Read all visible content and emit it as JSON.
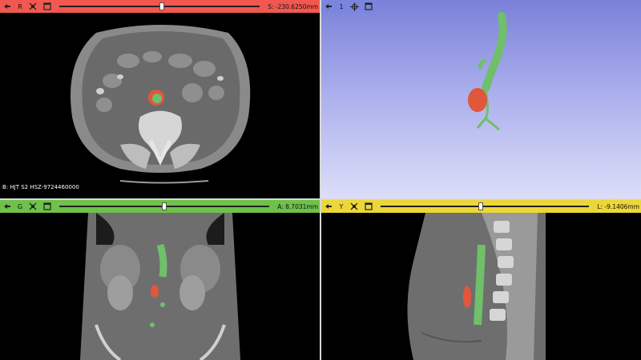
{
  "views": {
    "red": {
      "label": "R",
      "offset": "S: -230.6250mm",
      "slider_value": 0.51,
      "color": "#f2584f",
      "patient_id": "B: HJT S2 HSZ-9724460000"
    },
    "threed": {
      "label": "1",
      "color": "#7b85e0"
    },
    "green": {
      "label": "G",
      "offset": "A: 8.7031mm",
      "slider_value": 0.5,
      "color": "#6ec14a"
    },
    "yellow": {
      "label": "Y",
      "offset": "L: -9.1406mm",
      "slider_value": 0.48,
      "color": "#ecd738"
    }
  },
  "icons": {
    "pin": "pin-icon",
    "link": "link-icon",
    "crosshair": "crosshair-icon",
    "window": "window-icon"
  },
  "segmentation_colors": {
    "lumen": "#6fbf6b",
    "aneurysm": "#e0573c"
  }
}
